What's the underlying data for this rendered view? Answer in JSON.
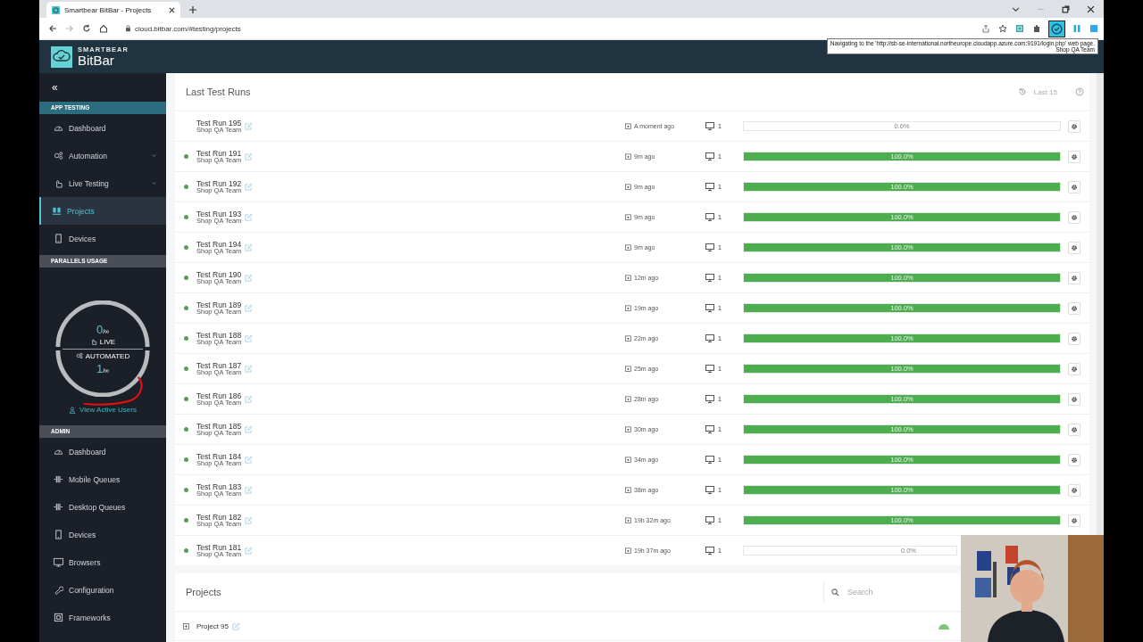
{
  "browser": {
    "tab_title": "Smartbear BitBar - Projects",
    "url": "cloud.bitbar.com/#testing/projects"
  },
  "tooltip": {
    "lines": [
      "Navigating to the 'http://sb-se-international.northeurope.cloudapp.azure.com:9191/login.php' web page.",
      "Shop QA Team"
    ]
  },
  "brand": {
    "company": "SMARTBEAR",
    "product": "BitBar"
  },
  "sidebar": {
    "collapse": "«",
    "app_testing": {
      "title": "APP TESTING",
      "items": [
        {
          "label": "Dashboard",
          "kind": "dashboard",
          "expandable": false,
          "selected": false
        },
        {
          "label": "Automation",
          "kind": "automation",
          "expandable": true,
          "selected": false
        },
        {
          "label": "Live Testing",
          "kind": "live",
          "expandable": true,
          "selected": false
        },
        {
          "label": "Projects",
          "kind": "projects",
          "expandable": false,
          "selected": true
        },
        {
          "label": "Devices",
          "kind": "device",
          "expandable": false,
          "selected": false
        }
      ]
    },
    "parallels": {
      "title": "PARALLELS USAGE",
      "live_count": "0",
      "live_limit": "/∞",
      "live_label": "LIVE",
      "automated_label": "AUTOMATED",
      "automated_count": "1",
      "automated_limit": "/∞",
      "link": "View Active Users"
    },
    "admin": {
      "title": "ADMIN",
      "items": [
        {
          "label": "Dashboard",
          "kind": "dashboard",
          "expandable": false,
          "selected": false
        },
        {
          "label": "Mobile Queues",
          "kind": "queue",
          "expandable": false,
          "selected": false
        },
        {
          "label": "Desktop Queues",
          "kind": "queue",
          "expandable": false,
          "selected": false
        },
        {
          "label": "Devices",
          "kind": "device",
          "expandable": false,
          "selected": false
        },
        {
          "label": "Browsers",
          "kind": "browser",
          "expandable": false,
          "selected": false
        },
        {
          "label": "Configuration",
          "kind": "config",
          "expandable": false,
          "selected": false
        },
        {
          "label": "Frameworks",
          "kind": "frameworks",
          "expandable": false,
          "selected": false
        }
      ]
    }
  },
  "runs": {
    "title": "Last Test Runs",
    "filter": "Last 15",
    "rows": [
      {
        "name": "Test Run 195",
        "team": "Shop QA Team",
        "finished": false,
        "time": "A moment ago",
        "devices": "1",
        "level": 0,
        "progress": "0.0%",
        "settings": true
      },
      {
        "name": "Test Run 191",
        "team": "Shop QA Team",
        "finished": true,
        "time": "9m ago",
        "devices": "1",
        "level": 1,
        "progress": "100.0%",
        "settings": true
      },
      {
        "name": "Test Run 192",
        "team": "Shop QA Team",
        "finished": true,
        "time": "9m ago",
        "devices": "1",
        "level": 1,
        "progress": "100.0%",
        "settings": true
      },
      {
        "name": "Test Run 193",
        "team": "Shop QA Team",
        "finished": true,
        "time": "9m ago",
        "devices": "1",
        "level": 1,
        "progress": "100.0%",
        "settings": true
      },
      {
        "name": "Test Run 194",
        "team": "Shop QA Team",
        "finished": true,
        "time": "9m ago",
        "devices": "1",
        "level": 1,
        "progress": "100.0%",
        "settings": true
      },
      {
        "name": "Test Run 190",
        "team": "Shop QA Team",
        "finished": true,
        "time": "12m ago",
        "devices": "1",
        "level": 1,
        "progress": "100.0%",
        "settings": true
      },
      {
        "name": "Test Run 189",
        "team": "Shop QA Team",
        "finished": true,
        "time": "19m ago",
        "devices": "1",
        "level": 1,
        "progress": "100.0%",
        "settings": true
      },
      {
        "name": "Test Run 188",
        "team": "Shop QA Team",
        "finished": true,
        "time": "22m ago",
        "devices": "1",
        "level": 1,
        "progress": "100.0%",
        "settings": true
      },
      {
        "name": "Test Run 187",
        "team": "Shop QA Team",
        "finished": true,
        "time": "25m ago",
        "devices": "1",
        "level": 1,
        "progress": "100.0%",
        "settings": true
      },
      {
        "name": "Test Run 186",
        "team": "Shop QA Team",
        "finished": true,
        "time": "28m ago",
        "devices": "1",
        "level": 1,
        "progress": "100.0%",
        "settings": true
      },
      {
        "name": "Test Run 185",
        "team": "Shop QA Team",
        "finished": true,
        "time": "30m ago",
        "devices": "1",
        "level": 1,
        "progress": "100.0%",
        "settings": true
      },
      {
        "name": "Test Run 184",
        "team": "Shop QA Team",
        "finished": true,
        "time": "34m ago",
        "devices": "1",
        "level": 1,
        "progress": "100.0%",
        "settings": true
      },
      {
        "name": "Test Run 183",
        "team": "Shop QA Team",
        "finished": true,
        "time": "38m ago",
        "devices": "1",
        "level": 1,
        "progress": "100.0%",
        "settings": true
      },
      {
        "name": "Test Run 182",
        "team": "Shop QA Team",
        "finished": true,
        "time": "19h 32m ago",
        "devices": "1",
        "level": 1,
        "progress": "100.0%",
        "settings": true
      },
      {
        "name": "Test Run 181",
        "team": "Shop QA Team",
        "finished": true,
        "time": "19h 37m ago",
        "devices": "1",
        "level": 0,
        "progress": "0.0%",
        "settings": false
      }
    ]
  },
  "projects": {
    "title": "Projects",
    "search_placeholder": "Search",
    "rows": [
      {
        "name": "Project 95",
        "kind": "android"
      }
    ]
  }
}
